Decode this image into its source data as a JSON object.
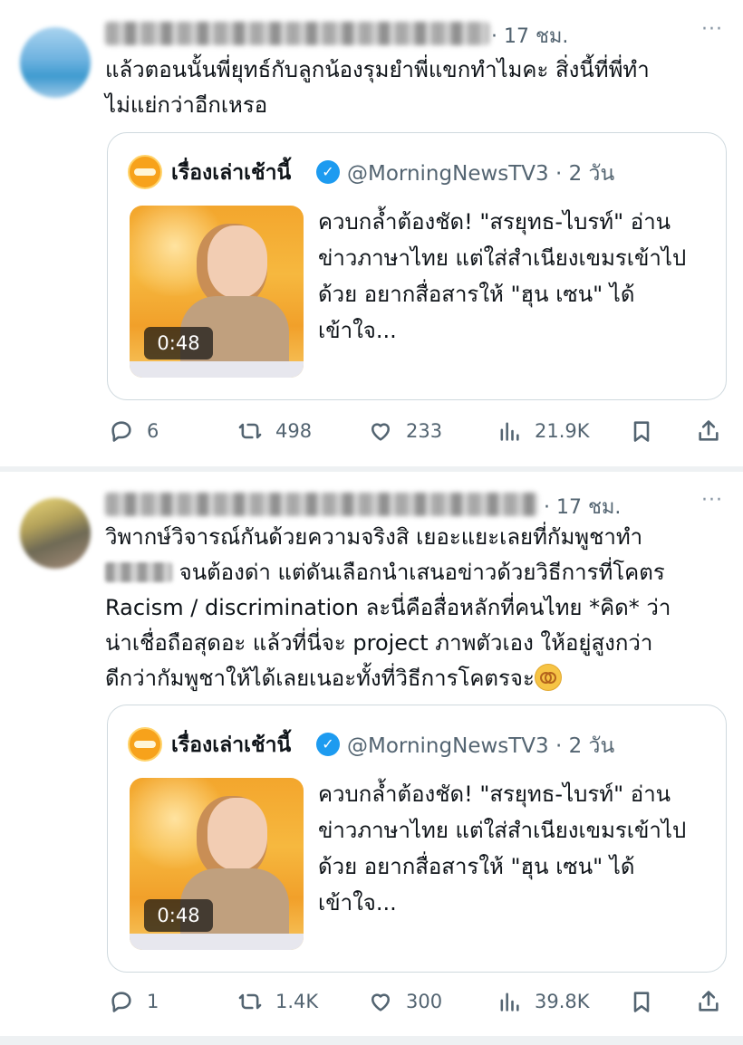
{
  "tweets": [
    {
      "time": "· 17 ชม.",
      "text": "แล้วตอนนั้นพี่ยุทธ์กับลูกน้องรุมยำพี่แขกทำไมคะ สิ่งนี้ที่พี่ทำ\nไม่แย่กว่าอีกเหรอ",
      "quote": {
        "name": "เรื่องเล่าเช้านี้",
        "handle": "@MorningNewsTV3 · 2 วัน",
        "duration": "0:48",
        "text": "ควบกล้ำต้องชัด! \"สรยุทธ-ไบรท์\" อ่านข่าวภาษาไทย แต่ใส่สำเนียงเขมรเข้าไปด้วย อยากสื่อสารให้ \"ฮุน เซน\" ได้เข้าใจ..."
      },
      "replies": "6",
      "reposts": "498",
      "likes": "233",
      "views": "21.9K"
    },
    {
      "time": "· 17 ชม.",
      "text_line1": "วิพากษ์วิจารณ์กันด้วยความจริงสิ เยอะแยะเลยที่กัมพูชาทำ",
      "text_line2": " จนต้องด่า แต่ดันเลือกนำเสนอข่าวด้วยวิธีการที่โคตร",
      "text_rest": "Racism / discrimination ละนี่คือสื่อหลักที่คนไทย *คิด* ว่า\nน่าเชื่อถือสุดอะ แล้วที่นี่จะ project ภาพตัวเอง ให้อยู่สูงกว่า\nดีกว่ากัมพูชาให้ได้เลยเนอะทั้งที่วิธีการโคตรจะ",
      "quote": {
        "name": "เรื่องเล่าเช้านี้",
        "handle": "@MorningNewsTV3 · 2 วัน",
        "duration": "0:48",
        "text": "ควบกล้ำต้องชัด! \"สรยุทธ-ไบรท์\" อ่านข่าวภาษาไทย แต่ใส่สำเนียงเขมรเข้าไปด้วย อยากสื่อสารให้ \"ฮุน เซน\" ได้เข้าใจ..."
      },
      "replies": "1",
      "reposts": "1.4K",
      "likes": "300",
      "views": "39.8K"
    }
  ],
  "more_label": "···",
  "verified_icon": "verified-check-icon",
  "colors": {
    "muted": "#536471",
    "verified": "#1d9bf0",
    "border": "#cfd9de"
  }
}
